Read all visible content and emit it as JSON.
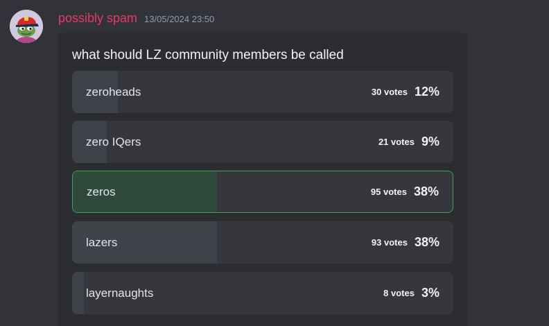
{
  "message": {
    "username": "possibly spam",
    "timestamp": "13/05/2024 23:50",
    "avatar_icon": "red-cap-frog-avatar"
  },
  "poll": {
    "question": "what should LZ community members be called",
    "answers": [
      {
        "label": "zeroheads",
        "votes": "30 votes",
        "percent": "12%",
        "share": 0.12,
        "selected": false
      },
      {
        "label": "zero IQers",
        "votes": "21 votes",
        "percent": "9%",
        "share": 0.09,
        "selected": false
      },
      {
        "label": "zeros",
        "votes": "95 votes",
        "percent": "38%",
        "share": 0.38,
        "selected": true
      },
      {
        "label": "lazers",
        "votes": "93 votes",
        "percent": "38%",
        "share": 0.38,
        "selected": false
      },
      {
        "label": "layernaughts",
        "votes": "8 votes",
        "percent": "3%",
        "share": 0.03,
        "selected": false
      }
    ]
  },
  "colors": {
    "background": "#313338",
    "card": "#2b2d31",
    "username": "#e8386a",
    "selected_border": "#3ba55c",
    "selected_fill": "#2f4a3c"
  }
}
